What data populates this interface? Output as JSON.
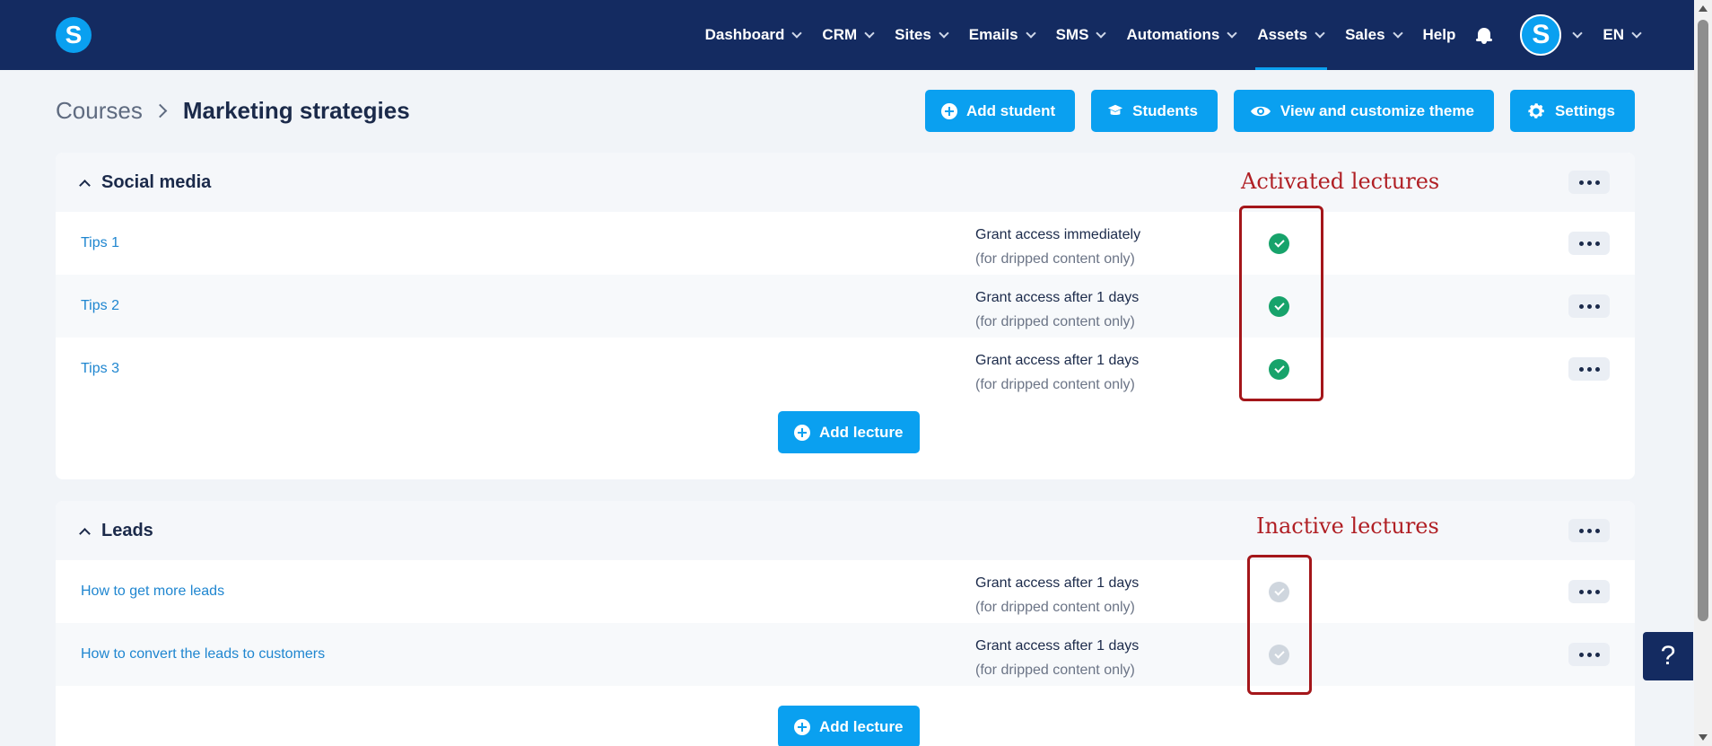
{
  "nav": {
    "logo_letter": "S",
    "items": [
      {
        "label": "Dashboard",
        "dropdown": true
      },
      {
        "label": "CRM",
        "dropdown": true
      },
      {
        "label": "Sites",
        "dropdown": true
      },
      {
        "label": "Emails",
        "dropdown": true
      },
      {
        "label": "SMS",
        "dropdown": true
      },
      {
        "label": "Automations",
        "dropdown": true
      },
      {
        "label": "Assets",
        "dropdown": true,
        "active": true
      },
      {
        "label": "Sales",
        "dropdown": true
      },
      {
        "label": "Help",
        "dropdown": false
      }
    ],
    "avatar_letter": "S",
    "language": "EN"
  },
  "breadcrumb": {
    "root": "Courses",
    "current": "Marketing strategies"
  },
  "actions": {
    "add_student": "Add student",
    "students": "Students",
    "view_theme": "View and customize theme",
    "settings": "Settings"
  },
  "sections": [
    {
      "title": "Social media",
      "lectures": [
        {
          "title": "Tips 1",
          "access": "Grant access immediately",
          "note": "(for dripped content only)",
          "active": true
        },
        {
          "title": "Tips 2",
          "access": "Grant access after 1 days",
          "note": "(for dripped content only)",
          "active": true
        },
        {
          "title": "Tips 3",
          "access": "Grant access after 1 days",
          "note": "(for dripped content only)",
          "active": true
        }
      ],
      "add_label": "Add lecture"
    },
    {
      "title": "Leads",
      "lectures": [
        {
          "title": "How to get more leads",
          "access": "Grant access after 1 days",
          "note": "(for dripped content only)",
          "active": false
        },
        {
          "title": "How to convert the leads to customers",
          "access": "Grant access after 1 days",
          "note": "(for dripped content only)",
          "active": false
        }
      ],
      "add_label": "Add lecture"
    }
  ],
  "annotations": {
    "activated": "Activated lectures",
    "inactive": "Inactive lectures"
  },
  "help_label": "?",
  "colors": {
    "navbar": "#142b61",
    "accent": "#0aa0f0",
    "active_status": "#17a36b",
    "inactive_status": "#cfd6de",
    "annotation": "#b01f24"
  }
}
